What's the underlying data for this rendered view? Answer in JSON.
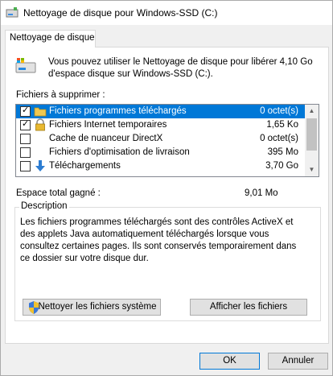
{
  "window": {
    "title": "Nettoyage de disque pour Windows-SSD (C:)"
  },
  "tab": {
    "label": "Nettoyage de disque"
  },
  "intro": {
    "text": "Vous pouvez utiliser le Nettoyage de disque pour libérer 4,10 Go d'espace disque sur Windows-SSD (C:).",
    "icon": "drive-cleanup-icon"
  },
  "files_to_delete": {
    "label": "Fichiers à supprimer :",
    "items": [
      {
        "label": "Fichiers programmes téléchargés",
        "size": "0 octet(s)",
        "checked": true,
        "selected": true,
        "icon": "folder-icon"
      },
      {
        "label": "Fichiers Internet temporaires",
        "size": "1,65 Ko",
        "checked": true,
        "selected": false,
        "icon": "lock-icon"
      },
      {
        "label": "Cache de nuanceur DirectX",
        "size": "0 octet(s)",
        "checked": false,
        "selected": false,
        "icon": ""
      },
      {
        "label": "Fichiers d'optimisation de livraison",
        "size": "395 Mo",
        "checked": false,
        "selected": false,
        "icon": ""
      },
      {
        "label": "Téléchargements",
        "size": "3,70 Go",
        "checked": false,
        "selected": false,
        "icon": "download-arrow-icon"
      }
    ]
  },
  "total": {
    "label": "Espace total gagné :",
    "value": "9,01 Mo"
  },
  "description": {
    "title": "Description",
    "text": "Les fichiers programmes téléchargés sont des contrôles ActiveX et des applets Java automatiquement téléchargés lorsque vous consultez certaines pages. Ils sont conservés temporairement dans ce dossier sur votre disque dur."
  },
  "buttons": {
    "cleanup_system": "Nettoyer les fichiers système",
    "view_files": "Afficher les fichiers",
    "ok": "OK",
    "cancel": "Annuler"
  },
  "colors": {
    "selection": "#0078d7",
    "button_face": "#e1e1e1",
    "panel": "#ffffff",
    "background": "#f0f0f0"
  }
}
